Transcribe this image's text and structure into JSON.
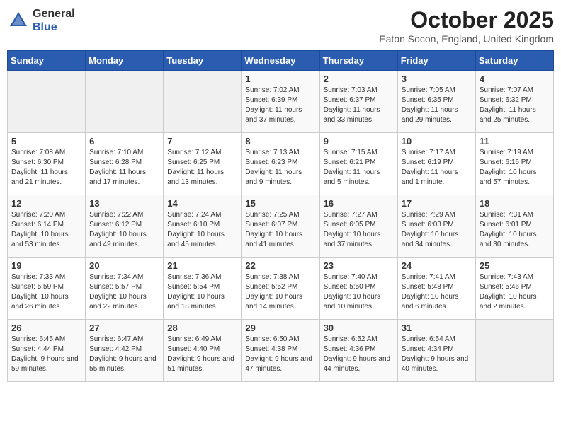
{
  "header": {
    "logo_line1": "General",
    "logo_line2": "Blue",
    "month": "October 2025",
    "location": "Eaton Socon, England, United Kingdom"
  },
  "weekdays": [
    "Sunday",
    "Monday",
    "Tuesday",
    "Wednesday",
    "Thursday",
    "Friday",
    "Saturday"
  ],
  "weeks": [
    [
      {
        "day": "",
        "sunrise": "",
        "sunset": "",
        "daylight": "",
        "empty": true
      },
      {
        "day": "",
        "sunrise": "",
        "sunset": "",
        "daylight": "",
        "empty": true
      },
      {
        "day": "",
        "sunrise": "",
        "sunset": "",
        "daylight": "",
        "empty": true
      },
      {
        "day": "1",
        "sunrise": "Sunrise: 7:02 AM",
        "sunset": "Sunset: 6:39 PM",
        "daylight": "Daylight: 11 hours and 37 minutes."
      },
      {
        "day": "2",
        "sunrise": "Sunrise: 7:03 AM",
        "sunset": "Sunset: 6:37 PM",
        "daylight": "Daylight: 11 hours and 33 minutes."
      },
      {
        "day": "3",
        "sunrise": "Sunrise: 7:05 AM",
        "sunset": "Sunset: 6:35 PM",
        "daylight": "Daylight: 11 hours and 29 minutes."
      },
      {
        "day": "4",
        "sunrise": "Sunrise: 7:07 AM",
        "sunset": "Sunset: 6:32 PM",
        "daylight": "Daylight: 11 hours and 25 minutes."
      }
    ],
    [
      {
        "day": "5",
        "sunrise": "Sunrise: 7:08 AM",
        "sunset": "Sunset: 6:30 PM",
        "daylight": "Daylight: 11 hours and 21 minutes."
      },
      {
        "day": "6",
        "sunrise": "Sunrise: 7:10 AM",
        "sunset": "Sunset: 6:28 PM",
        "daylight": "Daylight: 11 hours and 17 minutes."
      },
      {
        "day": "7",
        "sunrise": "Sunrise: 7:12 AM",
        "sunset": "Sunset: 6:25 PM",
        "daylight": "Daylight: 11 hours and 13 minutes."
      },
      {
        "day": "8",
        "sunrise": "Sunrise: 7:13 AM",
        "sunset": "Sunset: 6:23 PM",
        "daylight": "Daylight: 11 hours and 9 minutes."
      },
      {
        "day": "9",
        "sunrise": "Sunrise: 7:15 AM",
        "sunset": "Sunset: 6:21 PM",
        "daylight": "Daylight: 11 hours and 5 minutes."
      },
      {
        "day": "10",
        "sunrise": "Sunrise: 7:17 AM",
        "sunset": "Sunset: 6:19 PM",
        "daylight": "Daylight: 11 hours and 1 minute."
      },
      {
        "day": "11",
        "sunrise": "Sunrise: 7:19 AM",
        "sunset": "Sunset: 6:16 PM",
        "daylight": "Daylight: 10 hours and 57 minutes."
      }
    ],
    [
      {
        "day": "12",
        "sunrise": "Sunrise: 7:20 AM",
        "sunset": "Sunset: 6:14 PM",
        "daylight": "Daylight: 10 hours and 53 minutes."
      },
      {
        "day": "13",
        "sunrise": "Sunrise: 7:22 AM",
        "sunset": "Sunset: 6:12 PM",
        "daylight": "Daylight: 10 hours and 49 minutes."
      },
      {
        "day": "14",
        "sunrise": "Sunrise: 7:24 AM",
        "sunset": "Sunset: 6:10 PM",
        "daylight": "Daylight: 10 hours and 45 minutes."
      },
      {
        "day": "15",
        "sunrise": "Sunrise: 7:25 AM",
        "sunset": "Sunset: 6:07 PM",
        "daylight": "Daylight: 10 hours and 41 minutes."
      },
      {
        "day": "16",
        "sunrise": "Sunrise: 7:27 AM",
        "sunset": "Sunset: 6:05 PM",
        "daylight": "Daylight: 10 hours and 37 minutes."
      },
      {
        "day": "17",
        "sunrise": "Sunrise: 7:29 AM",
        "sunset": "Sunset: 6:03 PM",
        "daylight": "Daylight: 10 hours and 34 minutes."
      },
      {
        "day": "18",
        "sunrise": "Sunrise: 7:31 AM",
        "sunset": "Sunset: 6:01 PM",
        "daylight": "Daylight: 10 hours and 30 minutes."
      }
    ],
    [
      {
        "day": "19",
        "sunrise": "Sunrise: 7:33 AM",
        "sunset": "Sunset: 5:59 PM",
        "daylight": "Daylight: 10 hours and 26 minutes."
      },
      {
        "day": "20",
        "sunrise": "Sunrise: 7:34 AM",
        "sunset": "Sunset: 5:57 PM",
        "daylight": "Daylight: 10 hours and 22 minutes."
      },
      {
        "day": "21",
        "sunrise": "Sunrise: 7:36 AM",
        "sunset": "Sunset: 5:54 PM",
        "daylight": "Daylight: 10 hours and 18 minutes."
      },
      {
        "day": "22",
        "sunrise": "Sunrise: 7:38 AM",
        "sunset": "Sunset: 5:52 PM",
        "daylight": "Daylight: 10 hours and 14 minutes."
      },
      {
        "day": "23",
        "sunrise": "Sunrise: 7:40 AM",
        "sunset": "Sunset: 5:50 PM",
        "daylight": "Daylight: 10 hours and 10 minutes."
      },
      {
        "day": "24",
        "sunrise": "Sunrise: 7:41 AM",
        "sunset": "Sunset: 5:48 PM",
        "daylight": "Daylight: 10 hours and 6 minutes."
      },
      {
        "day": "25",
        "sunrise": "Sunrise: 7:43 AM",
        "sunset": "Sunset: 5:46 PM",
        "daylight": "Daylight: 10 hours and 2 minutes."
      }
    ],
    [
      {
        "day": "26",
        "sunrise": "Sunrise: 6:45 AM",
        "sunset": "Sunset: 4:44 PM",
        "daylight": "Daylight: 9 hours and 59 minutes."
      },
      {
        "day": "27",
        "sunrise": "Sunrise: 6:47 AM",
        "sunset": "Sunset: 4:42 PM",
        "daylight": "Daylight: 9 hours and 55 minutes."
      },
      {
        "day": "28",
        "sunrise": "Sunrise: 6:49 AM",
        "sunset": "Sunset: 4:40 PM",
        "daylight": "Daylight: 9 hours and 51 minutes."
      },
      {
        "day": "29",
        "sunrise": "Sunrise: 6:50 AM",
        "sunset": "Sunset: 4:38 PM",
        "daylight": "Daylight: 9 hours and 47 minutes."
      },
      {
        "day": "30",
        "sunrise": "Sunrise: 6:52 AM",
        "sunset": "Sunset: 4:36 PM",
        "daylight": "Daylight: 9 hours and 44 minutes."
      },
      {
        "day": "31",
        "sunrise": "Sunrise: 6:54 AM",
        "sunset": "Sunset: 4:34 PM",
        "daylight": "Daylight: 9 hours and 40 minutes."
      },
      {
        "day": "",
        "sunrise": "",
        "sunset": "",
        "daylight": "",
        "empty": true
      }
    ]
  ]
}
